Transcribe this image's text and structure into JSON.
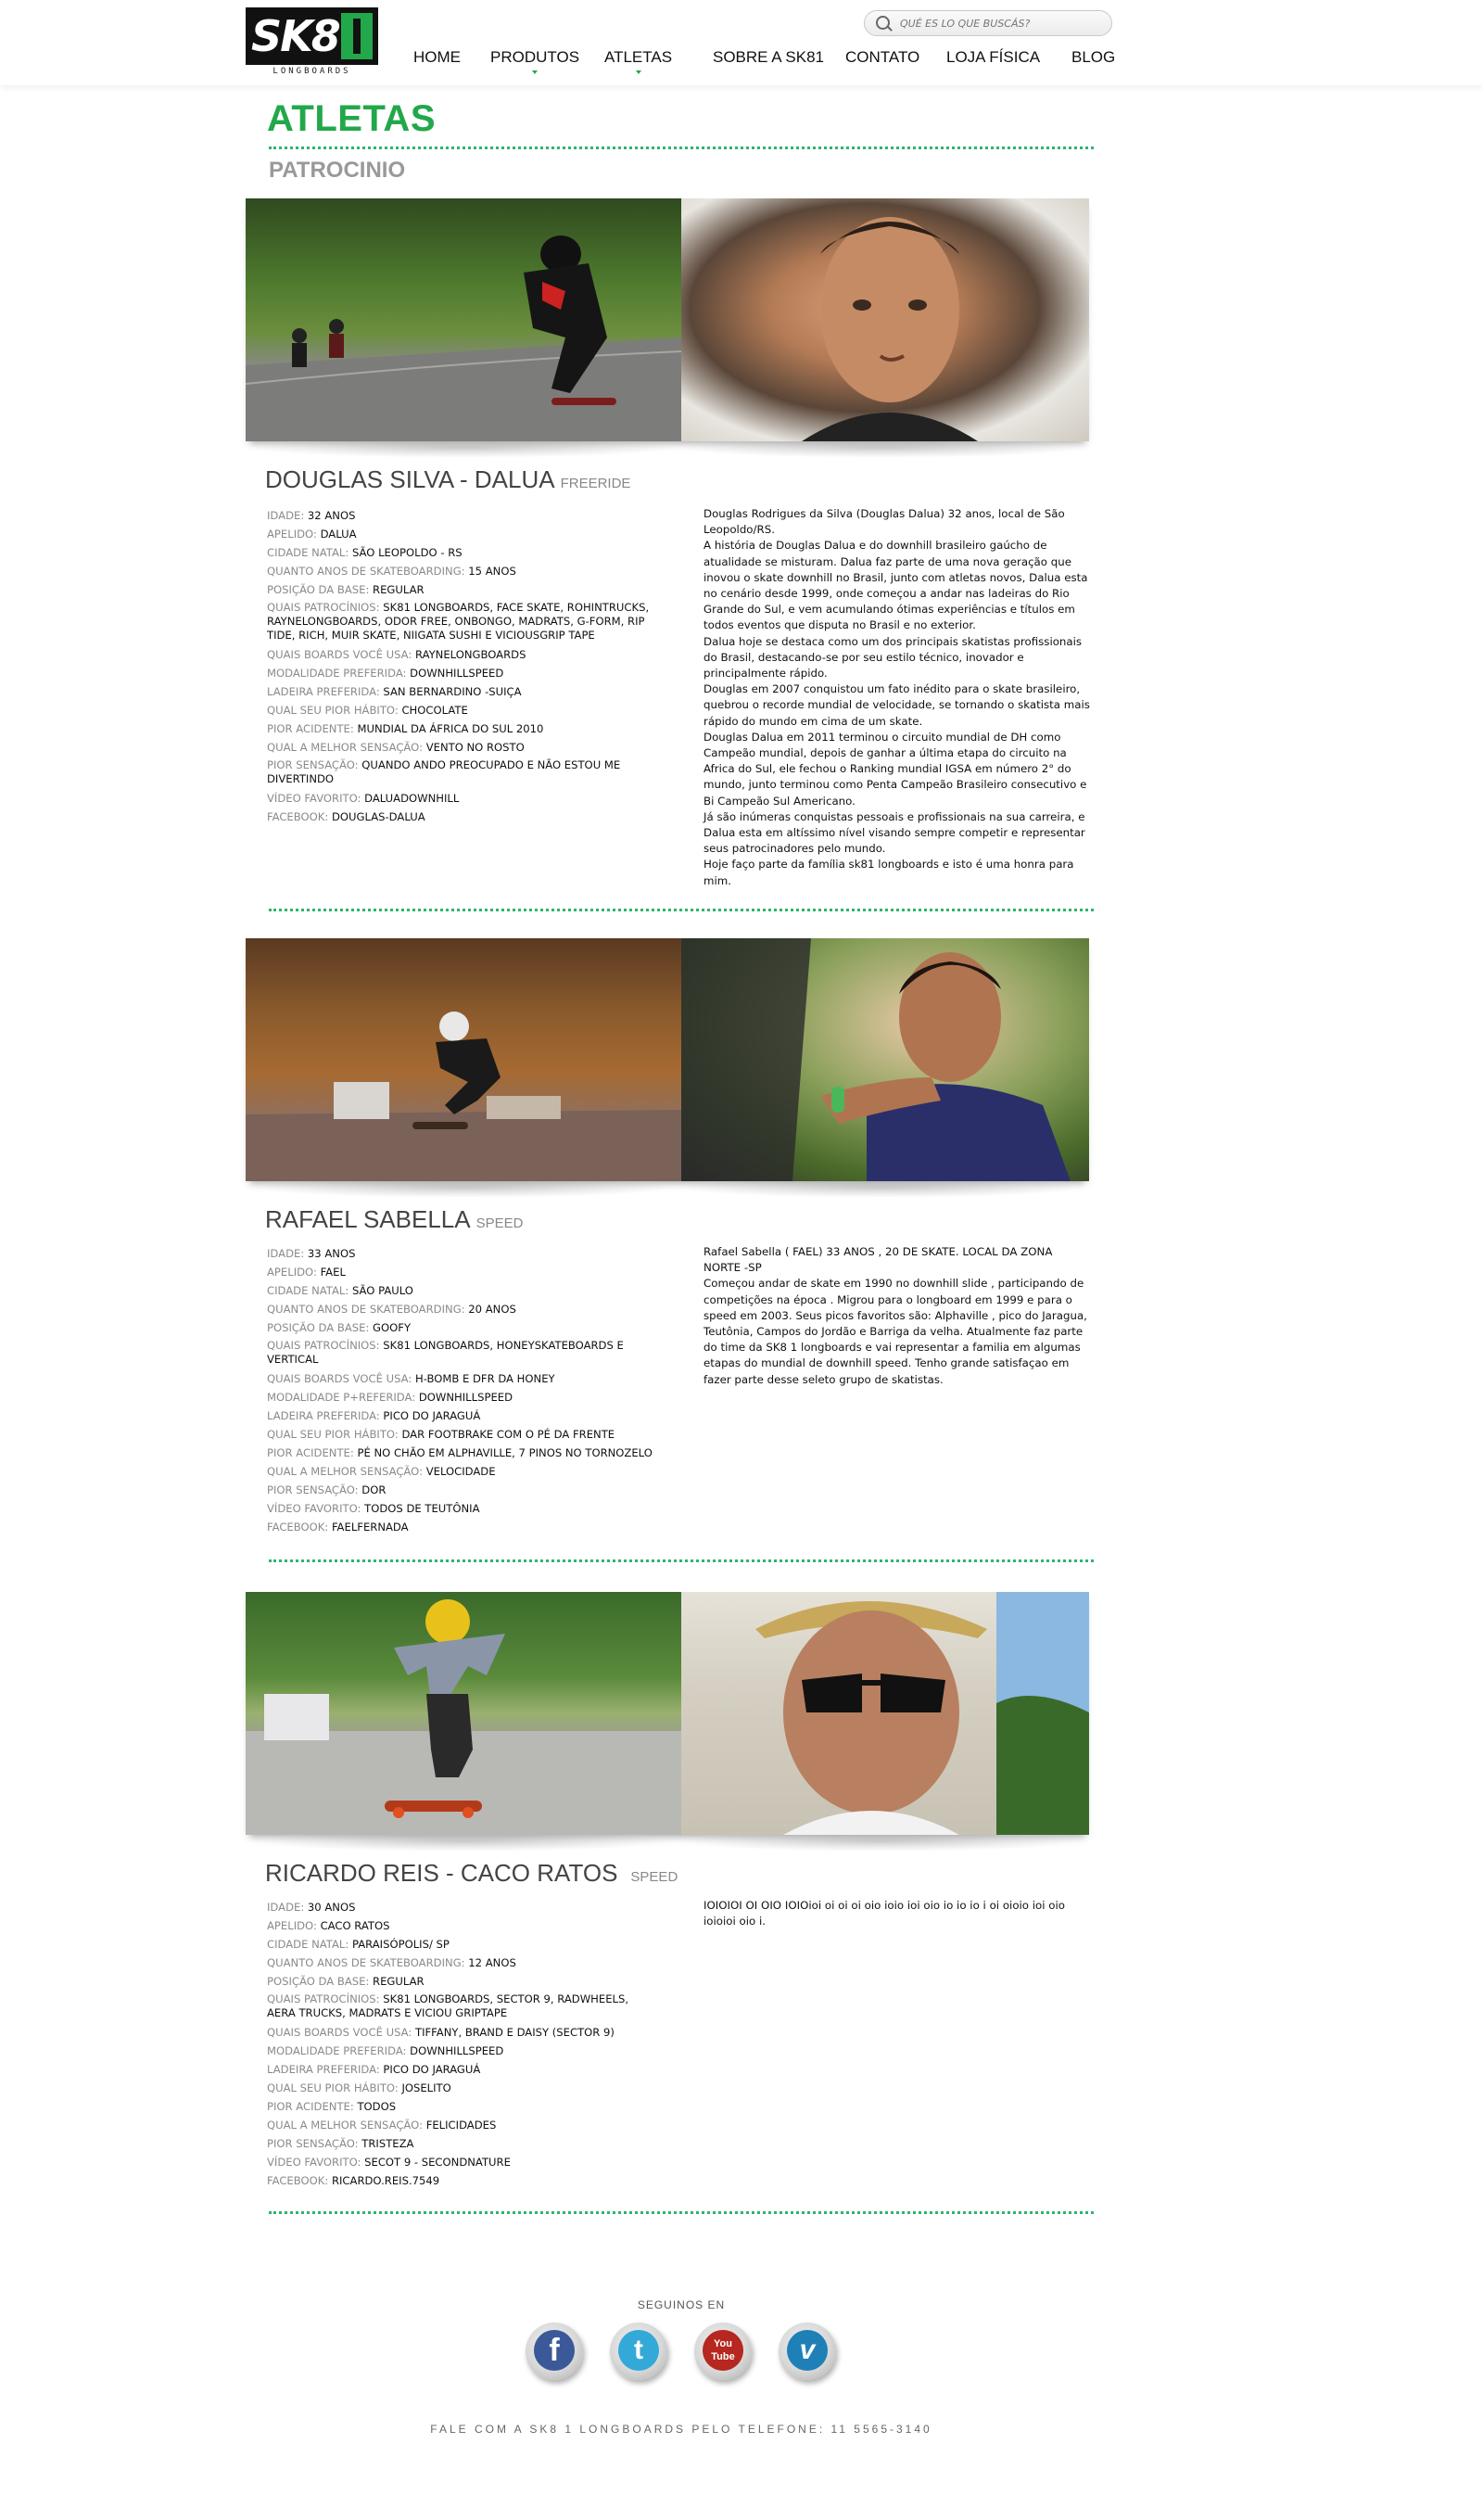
{
  "header": {
    "logo": {
      "main": "SK8",
      "sub": "LONGBOARDS"
    },
    "search": {
      "placeholder": "QUÉ ES LO QUE BUSCÁS?"
    },
    "nav": [
      "HOME",
      "PRODUTOS",
      "ATLETAS",
      "SOBRE A SK81",
      "CONTATO",
      "LOJA FÍSICA",
      "BLOG"
    ]
  },
  "page": {
    "title": "ATLETAS",
    "subtitle": "PATROCINIO"
  },
  "athletes": [
    {
      "name": "DOUGLAS SILVA - DALUA",
      "category": "FREERIDE",
      "facts": [
        {
          "label": "IDADE:",
          "value": "32 ANOS"
        },
        {
          "label": "APELIDO:",
          "value": "DALUA"
        },
        {
          "label": "CIDADE NATAL:",
          "value": "SÃO LEOPOLDO - RS"
        },
        {
          "label": "QUANTO ANOS DE SKATEBOARDING:",
          "value": "15 ANOS"
        },
        {
          "label": "POSIÇÃO DA BASE:",
          "value": "REGULAR"
        },
        {
          "label": "QUAIS PATROCÍNIOS:",
          "value": "SK81 LONGBOARDS, FACE SKATE, ROHINTRUCKS, RAYNELONGBOARDS, ODOR FREE, ONBONGO, MADRATS, G-FORM, RIP TIDE, RICH, MUIR SKATE, NIIGATA SUSHI E VICIOUSGRIP TAPE"
        },
        {
          "label": "QUAIS BOARDS VOCÊ USA:",
          "value": "RAYNELONGBOARDS"
        },
        {
          "label": "MODALIDADE PREFERIDA:",
          "value": "DOWNHILLSPEED"
        },
        {
          "label": "LADEIRA PREFERIDA:",
          "value": "SAN BERNARDINO -SUIÇA"
        },
        {
          "label": "QUAL SEU PIOR HÁBITO:",
          "value": "CHOCOLATE"
        },
        {
          "label": "PIOR ACIDENTE:",
          "value": "MUNDIAL DA ÁFRICA DO SUL 2010"
        },
        {
          "label": "QUAL A MELHOR SENSAÇÃO:",
          "value": "VENTO NO ROSTO"
        },
        {
          "label": "PIOR SENSAÇÃO:",
          "value": "QUANDO ANDO PREOCUPADO E NÃO ESTOU ME DIVERTINDO"
        },
        {
          "label": "VÍDEO FAVORITO:",
          "value": "DALUADOWNHILL"
        },
        {
          "label": "FACEBOOK:",
          "value": "DOUGLAS-DALUA"
        }
      ],
      "bio": [
        "Douglas Rodrigues da Silva (Douglas Dalua) 32 anos, local de São Leopoldo/RS.",
        "A história de Douglas Dalua e do downhill brasileiro gaúcho de atualidade se misturam. Dalua faz parte de uma nova geração que inovou o skate downhill no Brasil, junto com atletas novos, Dalua esta no cenário desde 1999, onde começou a andar nas ladeiras do Rio Grande do Sul, e vem acumulando ótimas experiências e títulos em todos eventos que disputa no Brasil e no exterior.",
        "Dalua hoje se destaca como um dos principais skatistas profissionais do Brasil, destacando-se por seu estilo técnico, inovador e principalmente rápido.",
        "Douglas em 2007 conquistou um fato inédito para o skate brasileiro, quebrou o recorde mundial de velocidade, se tornando o skatista mais rápido do mundo em cima de um skate.",
        "Douglas Dalua em 2011 terminou o circuito mundial de DH como Campeão mundial, depois de ganhar a última etapa do circuito na Africa do Sul, ele fechou o Ranking mundial IGSA em número 2° do mundo, junto terminou como Penta Campeão Brasileiro consecutivo e Bi Campeão Sul Americano.",
        "Já são inúmeras conquistas pessoais e profissionais na sua carreira, e Dalua esta em altíssimo nível visando sempre competir e representar seus patrocinadores pelo mundo.",
        "Hoje faço parte da família sk81 longboards e isto é uma honra para mim."
      ]
    },
    {
      "name": "RAFAEL SABELLA",
      "category": "SPEED",
      "facts": [
        {
          "label": "IDADE:",
          "value": "33 ANOS"
        },
        {
          "label": "APELIDO:",
          "value": "FAEL"
        },
        {
          "label": "CIDADE NATAL:",
          "value": "SÃO PAULO"
        },
        {
          "label": "QUANTO ANOS DE SKATEBOARDING:",
          "value": "20 ANOS"
        },
        {
          "label": "POSIÇÃO DA BASE:",
          "value": "GOOFY"
        },
        {
          "label": "QUAIS PATROCÍNIOS:",
          "value": "SK81 LONGBOARDS, HONEYSKATEBOARDS E VERTICAL"
        },
        {
          "label": "QUAIS BOARDS VOCÊ USA:",
          "value": "H-BOMB E DFR DA HONEY"
        },
        {
          "label": "MODALIDADE P+REFERIDA:",
          "value": "DOWNHILLSPEED"
        },
        {
          "label": "LADEIRA PREFERIDA:",
          "value": "PICO DO JARAGUÁ"
        },
        {
          "label": "QUAL SEU PIOR HÁBITO:",
          "value": "DAR FOOTBRAKE COM O PÉ DA FRENTE"
        },
        {
          "label": "PIOR ACIDENTE:",
          "value": "PÉ NO CHÃO EM ALPHAVILLE, 7 PINOS NO TORNOZELO"
        },
        {
          "label": "QUAL A MELHOR SENSAÇÃO:",
          "value": "VELOCIDADE"
        },
        {
          "label": "PIOR SENSAÇÃO:",
          "value": "DOR"
        },
        {
          "label": "VÍDEO FAVORITO:",
          "value": "TODOS DE TEUTÔNIA"
        },
        {
          "label": "FACEBOOK:",
          "value": "FAELFERNADA"
        }
      ],
      "bio": [
        "Rafael Sabella ( FAEL) 33 ANOS , 20 DE SKATE. LOCAL DA ZONA NORTE -SP",
        "Começou andar de skate em 1990 no downhill slide , participando de competições na época . Migrou para o longboard em 1999 e para o speed em 2003. Seus picos favoritos são: Alphaville , pico do Jaragua, Teutônia, Campos do Jordão e Barriga da velha. Atualmente faz parte do time da SK8 1 longboards e vai representar a familia em algumas etapas do mundial de downhill speed. Tenho grande satisfaçao em fazer parte desse seleto grupo de skatistas."
      ]
    },
    {
      "name": "RICARDO REIS - CACO RATOS",
      "category": "SPEED",
      "facts": [
        {
          "label": "IDADE:",
          "value": "30 ANOS"
        },
        {
          "label": "APELIDO:",
          "value": "CACO RATOS"
        },
        {
          "label": "CIDADE NATAL:",
          "value": "PARAISÓPOLIS/ SP"
        },
        {
          "label": "QUANTO ANOS DE SKATEBOARDING:",
          "value": "12 ANOS"
        },
        {
          "label": "POSIÇÃO DA BASE:",
          "value": "REGULAR"
        },
        {
          "label": "QUAIS PATROCÍNIOS:",
          "value": "SK81 LONGBOARDS, SECTOR 9, RADWHEELS, AERA TRUCKS, MADRATS E VICIOU GRIPTAPE"
        },
        {
          "label": "QUAIS BOARDS VOCÊ USA:",
          "value": "TIFFANY, BRAND E DAISY (SECTOR 9)"
        },
        {
          "label": "MODALIDADE PREFERIDA:",
          "value": "DOWNHILLSPEED"
        },
        {
          "label": "LADEIRA PREFERIDA:",
          "value": "PICO DO JARAGUÁ"
        },
        {
          "label": "QUAL SEU PIOR HÁBITO:",
          "value": "JOSELITO"
        },
        {
          "label": "PIOR ACIDENTE:",
          "value": "TODOS"
        },
        {
          "label": "QUAL A MELHOR SENSAÇÃO:",
          "value": "FELICIDADES"
        },
        {
          "label": "PIOR SENSAÇÃO:",
          "value": "TRISTEZA"
        },
        {
          "label": "VÍDEO FAVORITO:",
          "value": " SECOT 9 - SECONDNATURE"
        },
        {
          "label": "FACEBOOK:",
          "value": "RICARDO.REIS.7549"
        }
      ],
      "bio": [
        "IOIOIOI OI OIO IOIOioi oi oi oi oio ioio ioi oio io io io i oi oioio ioi oio ioioioi oio i."
      ]
    }
  ],
  "social": {
    "label": "SEGUINOS EN",
    "icons": [
      {
        "name": "facebook-icon",
        "glyph": "f",
        "color": "#3b5998"
      },
      {
        "name": "twitter-icon",
        "glyph": "t",
        "color": "#33a9d8"
      },
      {
        "name": "youtube-icon",
        "glyph": "You\nTube",
        "color": "#b5271f"
      },
      {
        "name": "vimeo-icon",
        "glyph": "v",
        "color": "#1f80b8"
      }
    ]
  },
  "footer": {
    "text": "FALE COM A SK8 1 LONGBOARDS PELO TELEFONE: 11 5565-3140"
  }
}
